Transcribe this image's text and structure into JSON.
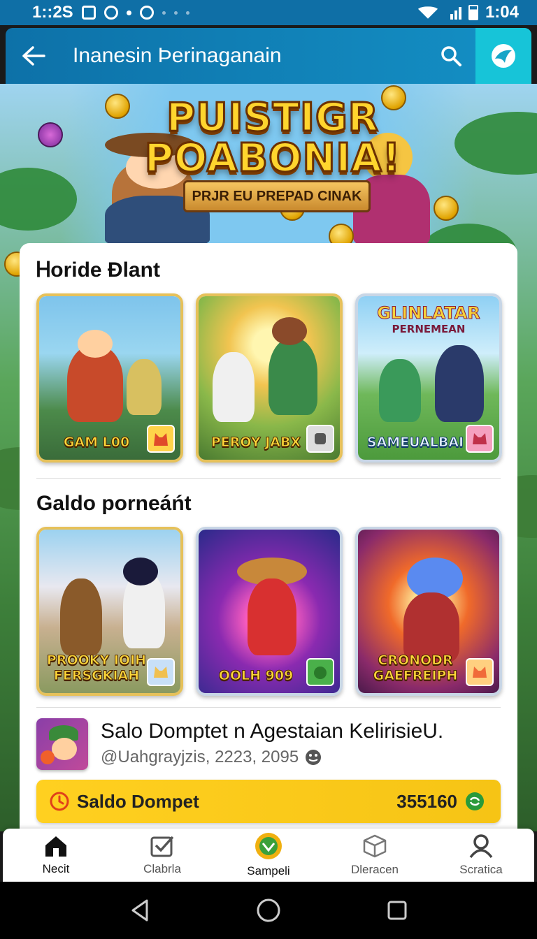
{
  "status_bar": {
    "time_left": "1::2S",
    "time_right": "1:04"
  },
  "header": {
    "title": "Inanesin Þerinaganain"
  },
  "hero": {
    "title_line1": "PUISTIGR",
    "title_line2": "POABONIA!",
    "ribbon": "PRJR EU PREPAD CINAK"
  },
  "section1": {
    "title": "Ꮋoride Ðlant",
    "tiles": [
      {
        "label": "GAM L00"
      },
      {
        "label": "PEROY JABX"
      },
      {
        "title": "GLINLATAR",
        "subtitle": "PERNEMEAN",
        "label": "SAMEUALBAI"
      }
    ]
  },
  "section2": {
    "title": "Galdo porneáńt",
    "tiles": [
      {
        "label": "PROOKY IOIH FERSGKIAH"
      },
      {
        "label": "OOLH 909"
      },
      {
        "label": "CRONODR GAEFREIPH"
      }
    ]
  },
  "wallet": {
    "title": "Salo Domptet n Agestaian KelirisieU.",
    "subtitle": "@Uahgrayjzis, 2223, 2095"
  },
  "saldo": {
    "label": "Saldo Dompet",
    "value": "355160"
  },
  "bottom_nav": [
    {
      "label": "Necit",
      "icon": "home-icon"
    },
    {
      "label": "Clabrla",
      "icon": "check-box-icon"
    },
    {
      "label": "Sampeli",
      "icon": "reward-icon"
    },
    {
      "label": "Dleracen",
      "icon": "package-icon"
    },
    {
      "label": "Scratica",
      "icon": "profile-icon"
    }
  ],
  "colors": {
    "header": "#0d71a8",
    "brand": "#17c4d8",
    "saldo": "#ffd020"
  }
}
